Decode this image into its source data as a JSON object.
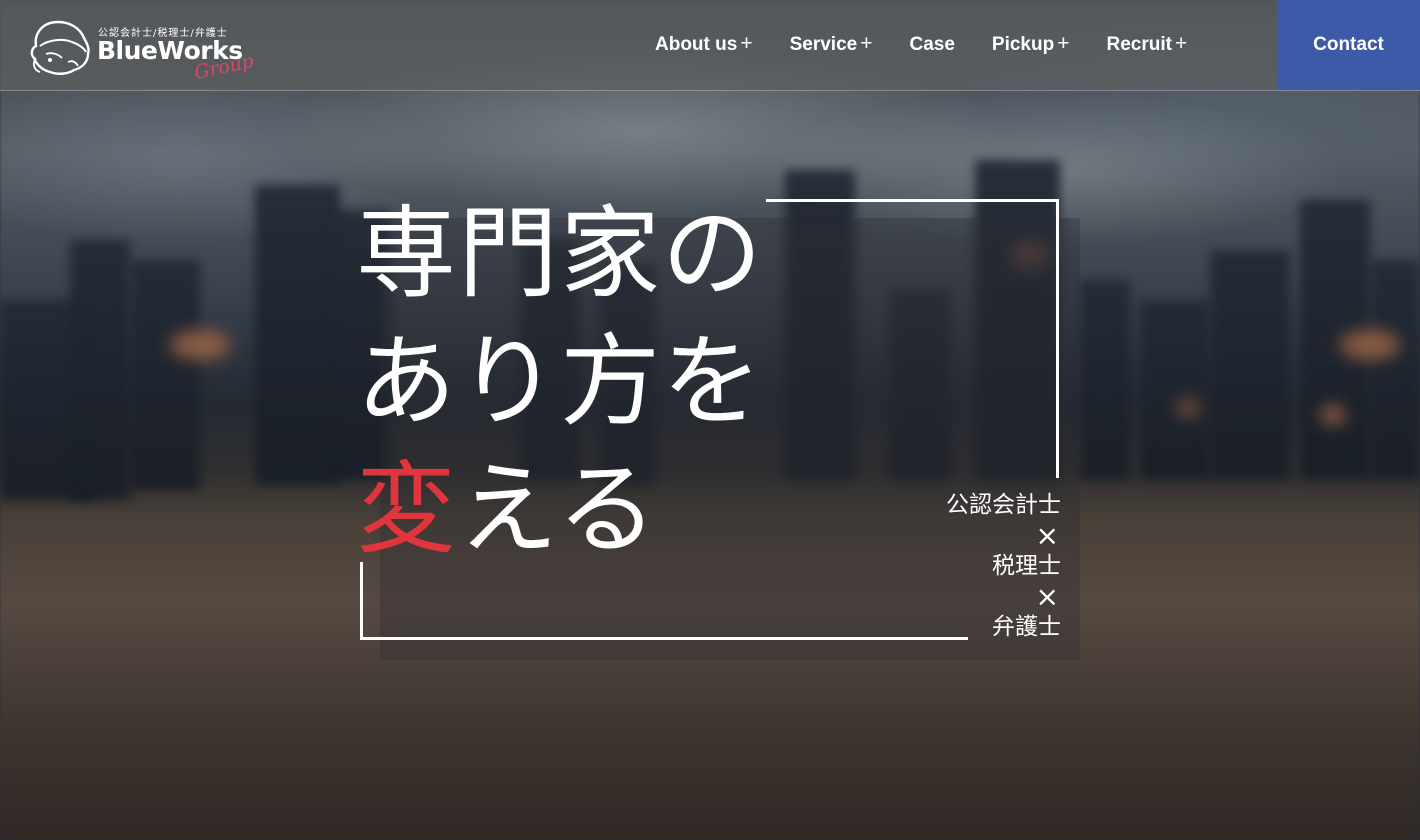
{
  "header": {
    "logo": {
      "subtitle": "公認会計士/税理士/弁護士",
      "name": "BlueWorks",
      "group": "Group"
    },
    "nav": [
      {
        "label": "About us",
        "suffix": "+"
      },
      {
        "label": "Service",
        "suffix": "+"
      },
      {
        "label": "Case",
        "suffix": ""
      },
      {
        "label": "Pickup",
        "suffix": "+"
      },
      {
        "label": "Recruit",
        "suffix": "+"
      }
    ],
    "contact_label": "Contact"
  },
  "hero": {
    "line1": "専門家の",
    "line2": "あり方を",
    "line3_accent": "変",
    "line3_rest": "える",
    "professions": {
      "p1": "公認会計士",
      "sep1": "×",
      "p2": "税理士",
      "sep2": "×",
      "p3": "弁護士"
    }
  },
  "colors": {
    "accent_red": "#e0353c",
    "contact_blue": "#3d5aa8",
    "logo_pink": "#d9466a"
  },
  "icons": {
    "logo_mark": "character-head-icon"
  }
}
